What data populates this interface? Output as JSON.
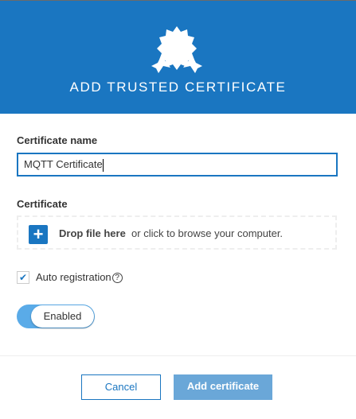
{
  "header": {
    "title": "ADD TRUSTED CERTIFICATE",
    "icon": "certificate-badge-icon",
    "color": "#1a76c1"
  },
  "form": {
    "name_label": "Certificate name",
    "name_value": "MQTT Certificate",
    "certificate_label": "Certificate",
    "drop_bold": "Drop file here",
    "drop_text": "or click to browse your computer.",
    "auto_registration_label": "Auto registration",
    "auto_registration_checked": true,
    "toggle_label": "Enabled",
    "toggle_on": true
  },
  "footer": {
    "cancel": "Cancel",
    "add": "Add certificate"
  }
}
